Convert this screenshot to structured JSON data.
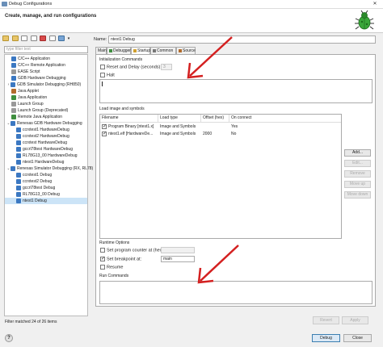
{
  "window": {
    "title": "Debug Configurations",
    "header_title": "Create, manage, and run configurations",
    "close_glyph": "✕"
  },
  "left": {
    "filter_placeholder": "type filter text",
    "tree": [
      {
        "label": "C/C++ Application",
        "level": 1,
        "icon_color": "#3b78c2"
      },
      {
        "label": "C/C++ Remote Application",
        "level": 1,
        "icon_color": "#3b78c2"
      },
      {
        "label": "EASE Script",
        "level": 1,
        "icon_color": "#999999"
      },
      {
        "label": "GDB Hardware Debugging",
        "level": 1,
        "icon_color": "#3b78c2"
      },
      {
        "label": "GDB Simulator Debugging (RH850)",
        "level": 0,
        "icon_color": "#3b78c2",
        "twisty": "›"
      },
      {
        "label": "Java Applet",
        "level": 1,
        "icon_color": "#b26b2c"
      },
      {
        "label": "Java Application",
        "level": 1,
        "icon_color": "#3f8f3f"
      },
      {
        "label": "Launch Group",
        "level": 1,
        "icon_color": "#999999"
      },
      {
        "label": "Launch Group (Deprecated)",
        "level": 1,
        "icon_color": "#999999"
      },
      {
        "label": "Remote Java Application",
        "level": 1,
        "icon_color": "#3f8f3f"
      },
      {
        "label": "Renesas GDB Hardware Debugging",
        "level": 0,
        "icon_color": "#3b78c2",
        "twisty": "⌄"
      },
      {
        "label": "ccrxtest1 HardwareDebug",
        "level": 2,
        "icon_color": "#3b78c2"
      },
      {
        "label": "ccrxtest2 HardwareDebug",
        "level": 2,
        "icon_color": "#3b78c2"
      },
      {
        "label": "ccrxtest HardwareDebug",
        "level": 2,
        "icon_color": "#3b78c2"
      },
      {
        "label": "gccrl78test HardwareDebug",
        "level": 2,
        "icon_color": "#3b78c2"
      },
      {
        "label": "RL78G13_00 HardwareDebug",
        "level": 2,
        "icon_color": "#3b78c2"
      },
      {
        "label": "ntest1 HardwareDebug",
        "level": 2,
        "icon_color": "#3b78c2"
      },
      {
        "label": "Renesas Simulator Debugging (RX, RL78)",
        "level": 0,
        "icon_color": "#3b78c2",
        "twisty": "⌄"
      },
      {
        "label": "ccrxtest1 Debug",
        "level": 2,
        "icon_color": "#3b78c2"
      },
      {
        "label": "ccrxtest2 Debug",
        "level": 2,
        "icon_color": "#3b78c2"
      },
      {
        "label": "gccrl78test Debug",
        "level": 2,
        "icon_color": "#3b78c2"
      },
      {
        "label": "RL78G13_00 Debug",
        "level": 2,
        "icon_color": "#3b78c2"
      },
      {
        "label": "ntest1 Debug",
        "level": 2,
        "icon_color": "#3b78c2",
        "selected": true
      }
    ],
    "status": "Filter matched 24 of 26 items"
  },
  "right": {
    "name_label": "Name:",
    "name_value": "ntest1 Debug",
    "tabs": [
      {
        "label": "Main"
      },
      {
        "label": "Debugger"
      },
      {
        "label": "Startup",
        "active": true
      },
      {
        "label": "Common"
      },
      {
        "label": "Source"
      }
    ],
    "init_commands": {
      "title": "Initialization Commands",
      "reset_label": "Reset and Delay (seconds):",
      "reset_value": "3",
      "halt_label": "Halt"
    },
    "load": {
      "title": "Load image and symbols",
      "columns": [
        "Filename",
        "Load type",
        "Offset (hex)",
        "On connect"
      ],
      "rows": [
        {
          "filename": "Program Binary [ntest1.x]",
          "load_type": "Image and Symbols",
          "offset": "",
          "on_connect": "Yes",
          "checked": true
        },
        {
          "filename": "ntest1.elf [HardwareDe...",
          "load_type": "Image and Symbols",
          "offset": "2000",
          "on_connect": "No",
          "checked": true
        }
      ],
      "buttons": [
        {
          "label": "Add...",
          "disabled": false
        },
        {
          "label": "Edit...",
          "disabled": true
        },
        {
          "label": "Remove",
          "disabled": true
        },
        {
          "label": "Move up",
          "disabled": true
        },
        {
          "label": "Move down",
          "disabled": true
        }
      ]
    },
    "runtime": {
      "title": "Runtime Options",
      "pc_label": "Set program counter at (hex):",
      "bp_label": "Set breakpoint at:",
      "bp_value": "main",
      "resume_label": "Resume"
    },
    "run_commands": {
      "title": "Run Commands"
    },
    "revert_label": "Revert",
    "apply_label": "Apply"
  },
  "footer": {
    "help_glyph": "?",
    "debug_label": "Debug",
    "close_label": "Close"
  },
  "colors": {
    "arrow": "#d42020",
    "selection": "#cce4f7"
  }
}
